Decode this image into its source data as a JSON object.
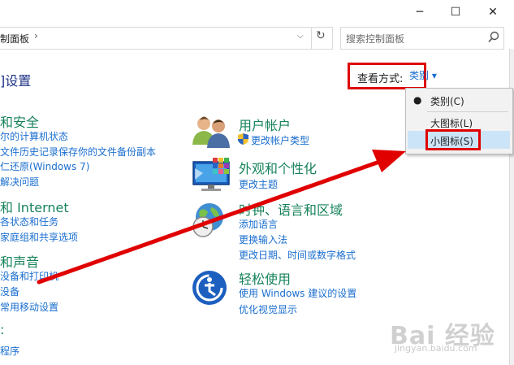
{
  "window": {
    "minimize": "─",
    "maximize": "☐",
    "close": "✕"
  },
  "address": {
    "path": "制面板",
    "separator": "›",
    "dropdown": "⌵",
    "refresh": "↻"
  },
  "search": {
    "placeholder": "搜索控制面板"
  },
  "page_title": "]设置",
  "view_by": {
    "label": "查看方式:",
    "current": "类别 ▾"
  },
  "view_menu": {
    "items": [
      {
        "label": "类别(C)",
        "selected": true
      },
      {
        "label": "大图标(L)",
        "selected": false
      },
      {
        "label": "小图标(S)",
        "selected": false,
        "highlighted": true
      }
    ]
  },
  "left_categories": [
    {
      "title": "和安全",
      "links": [
        "尔的计算机状态",
        "文件历史记录保存你的文件备份副本",
        "仁还原(Windows 7)",
        "解决问题"
      ]
    },
    {
      "title": "和 Internet",
      "links": [
        "各状态和任务",
        "家庭组和共享选项"
      ]
    },
    {
      "title": "和声音",
      "links": [
        "没备和打印机",
        "没备",
        "常用移动设置"
      ]
    },
    {
      "title": "",
      "links": [
        "程序"
      ]
    }
  ],
  "right_categories": [
    {
      "title": "用户帐户",
      "links": [
        "更改帐户类型"
      ]
    },
    {
      "title": "外观和个性化",
      "links": [
        "更改主题"
      ]
    },
    {
      "title": "时钟、语言和区域",
      "links": [
        "添加语言",
        "更换输入法",
        "更改日期、时间或数字格式"
      ]
    },
    {
      "title": "轻松使用",
      "links": [
        "使用 Windows 建议的设置",
        "优化视觉显示"
      ]
    }
  ],
  "watermark": {
    "text": "Bai 经验",
    "url": "jingyan.baidu.com"
  },
  "colors": {
    "heading": "#17835b",
    "link": "#1a6ecf",
    "annotation": "#e00000"
  }
}
